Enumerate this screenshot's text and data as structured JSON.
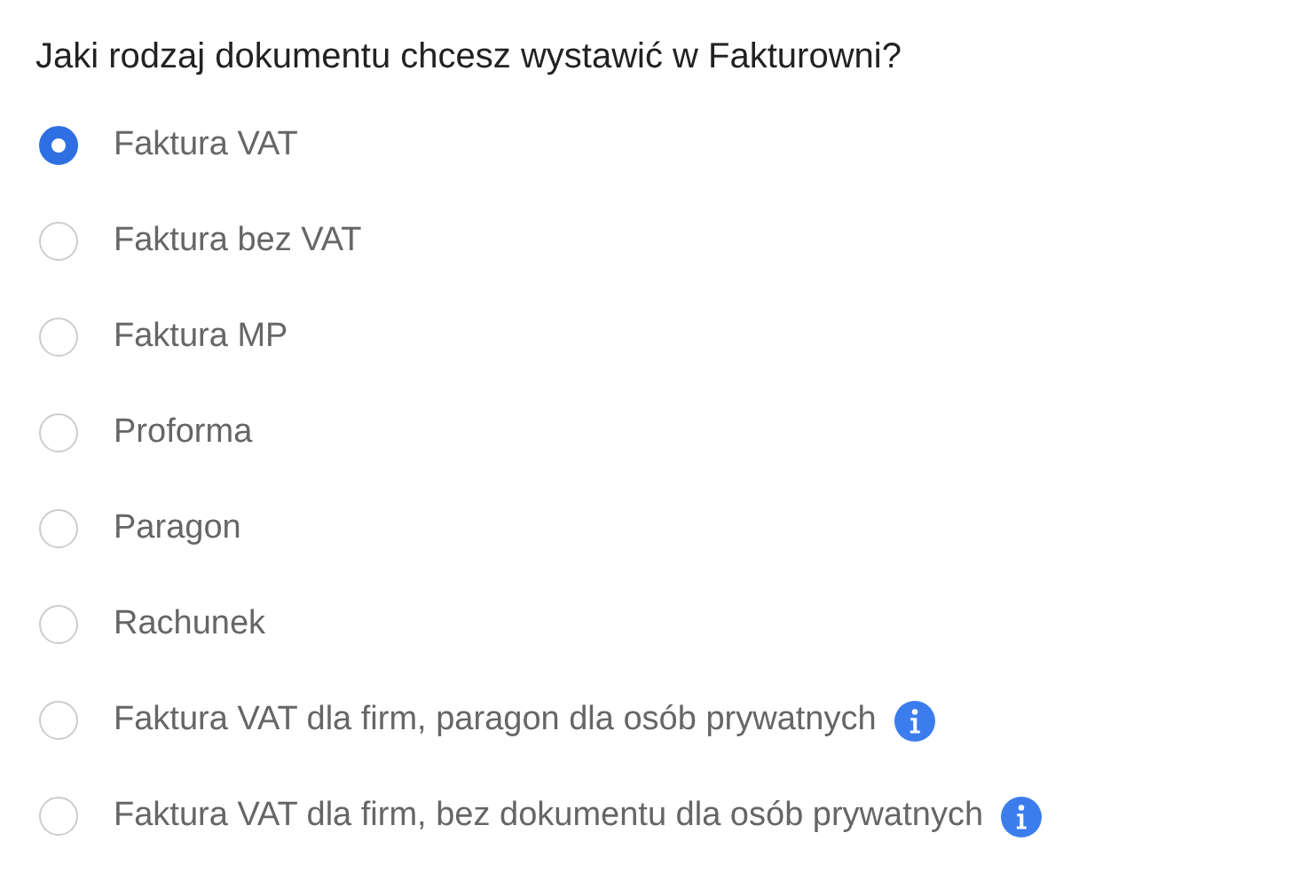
{
  "question": "Jaki rodzaj dokumentu chcesz wystawić w Fakturowni?",
  "options": [
    {
      "label": "Faktura VAT",
      "selected": true,
      "info": false
    },
    {
      "label": "Faktura bez VAT",
      "selected": false,
      "info": false
    },
    {
      "label": "Faktura MP",
      "selected": false,
      "info": false
    },
    {
      "label": "Proforma",
      "selected": false,
      "info": false
    },
    {
      "label": "Paragon",
      "selected": false,
      "info": false
    },
    {
      "label": "Rachunek",
      "selected": false,
      "info": false
    },
    {
      "label": "Faktura VAT dla firm, paragon dla osób prywatnych",
      "selected": false,
      "info": true
    },
    {
      "label": "Faktura VAT dla firm, bez dokumentu dla osób prywatnych",
      "selected": false,
      "info": true
    }
  ]
}
